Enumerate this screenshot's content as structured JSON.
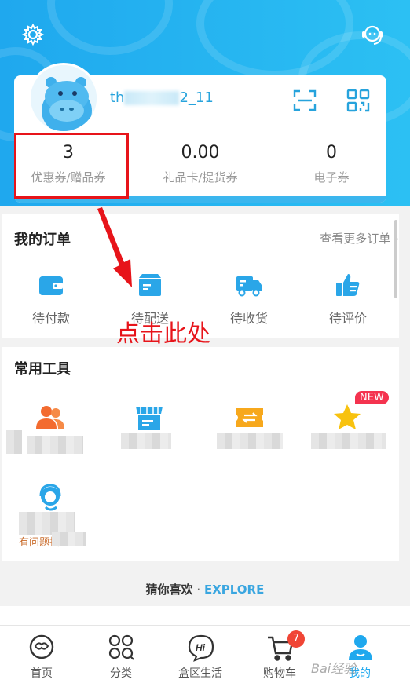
{
  "header": {
    "settings_icon": "gear-icon",
    "service_icon": "customer-service-icon"
  },
  "profile": {
    "username_prefix": "th",
    "username_suffix": "2_11",
    "scan_icon": "scan-icon",
    "qr_icon": "qr-code-icon",
    "stats": [
      {
        "value": "3",
        "label": "优惠券/赠品券"
      },
      {
        "value": "0.00",
        "label": "礼品卡/提货券"
      },
      {
        "value": "0",
        "label": "电子券"
      }
    ]
  },
  "orders": {
    "title": "我的订单",
    "more": "查看更多订单",
    "items": [
      {
        "label": "待付款",
        "icon": "wallet-icon"
      },
      {
        "label": "待配送",
        "icon": "box-icon"
      },
      {
        "label": "待收货",
        "icon": "truck-icon"
      },
      {
        "label": "待评价",
        "icon": "thumbs-up-icon"
      }
    ]
  },
  "annotation": {
    "text": "点击此处"
  },
  "tools": {
    "title": "常用工具",
    "new_badge": "NEW",
    "partial_label": "有问题找小盒"
  },
  "guess": {
    "cn": "猜你喜欢",
    "sep": " · ",
    "en": "EXPLORE"
  },
  "tabbar": {
    "items": [
      {
        "label": "首页",
        "icon": "home-icon"
      },
      {
        "label": "分类",
        "icon": "category-icon"
      },
      {
        "label": "盒区生活",
        "icon": "hi-chat-icon"
      },
      {
        "label": "购物车",
        "icon": "cart-icon",
        "badge": "7"
      },
      {
        "label": "我的",
        "icon": "profile-icon",
        "active": true
      }
    ]
  },
  "watermark": "Bai经验",
  "colors": {
    "brand": "#1fa8ee",
    "annotation_red": "#e7141a",
    "badge_red": "#f04535"
  }
}
